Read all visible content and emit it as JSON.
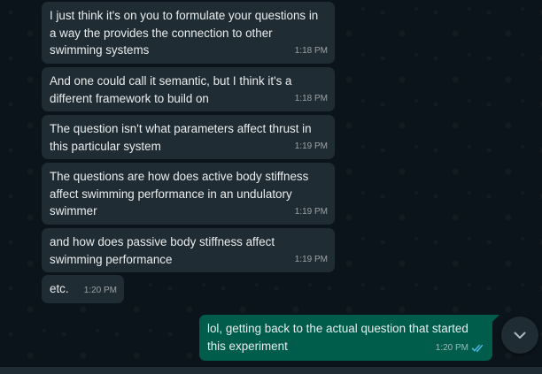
{
  "messages": [
    {
      "direction": "incoming",
      "text": "I just think it's on you to formulate your questions in a way the provides the connection to other swimming systems",
      "time": "1:18 PM"
    },
    {
      "direction": "incoming",
      "text": "And one could call it semantic, but I think it's a different framework to build on",
      "time": "1:18 PM"
    },
    {
      "direction": "incoming",
      "text": "The question isn't what parameters affect thrust in this particular system",
      "time": "1:19 PM"
    },
    {
      "direction": "incoming",
      "text": "The questions are how does active body stiffness affect swimming performance in an undulatory swimmer",
      "time": "1:19 PM"
    },
    {
      "direction": "incoming",
      "text": "and how does passive body stiffness affect swimming performance",
      "time": "1:19 PM"
    },
    {
      "direction": "incoming",
      "text": "etc.",
      "time": "1:20 PM"
    },
    {
      "direction": "outgoing",
      "text": "lol, getting back to the actual question that started this experiment",
      "time": "1:20 PM",
      "status": "read"
    }
  ],
  "scroll_down": {
    "icon": "chevron-down-icon"
  },
  "colors": {
    "background": "#0b141a",
    "incoming_bubble": "#202c33",
    "outgoing_bubble": "#005c4b",
    "text": "#e9edef",
    "read_ticks": "#53bdeb"
  }
}
